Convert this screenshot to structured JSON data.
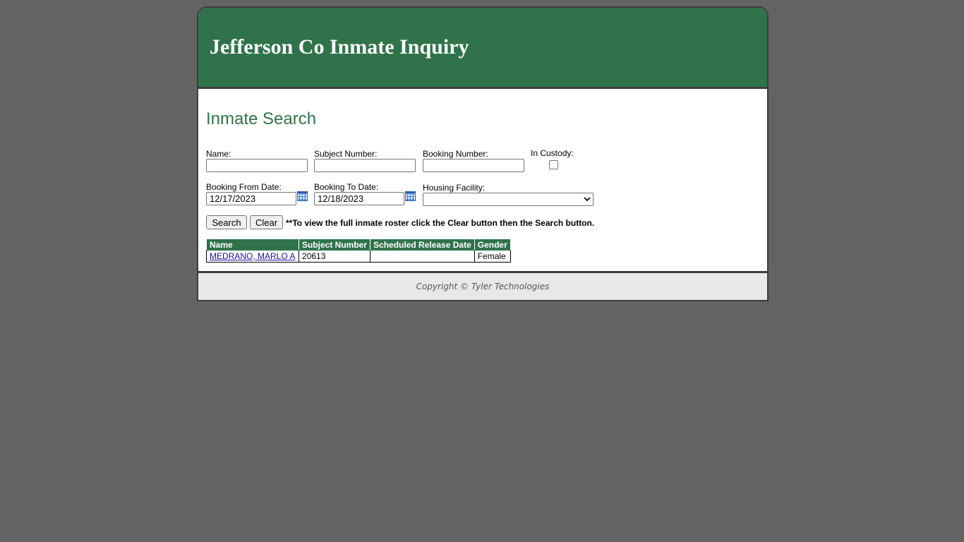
{
  "header": {
    "title": "Jefferson Co Inmate Inquiry"
  },
  "search": {
    "heading": "Inmate Search",
    "name_label": "Name:",
    "name_value": "",
    "subject_label": "Subject Number:",
    "subject_value": "",
    "booking_label": "Booking Number:",
    "booking_value": "",
    "custody_label": "In Custody:",
    "custody_checked": false,
    "from_label": "Booking From Date:",
    "from_value": "12/17/2023",
    "to_label": "Booking To Date:",
    "to_value": "12/18/2023",
    "facility_label": "Housing Facility:",
    "facility_value": "",
    "search_button": "Search",
    "clear_button": "Clear",
    "note": "**To view the full inmate roster click the Clear button then the Search button."
  },
  "results": {
    "columns": [
      "Name",
      "Subject Number",
      "Scheduled Release Date",
      "Gender"
    ],
    "rows": [
      {
        "name": "MEDRANO, MARLO A",
        "subject": "20613",
        "release": "",
        "gender": "Female"
      }
    ]
  },
  "footer": {
    "text": "Copyright © Tyler Technologies"
  },
  "icons": {
    "calendar": "calendar-icon",
    "dropdown": "chevron-down-icon"
  },
  "colors": {
    "brand_green": "#30734a",
    "background": "#636363"
  }
}
